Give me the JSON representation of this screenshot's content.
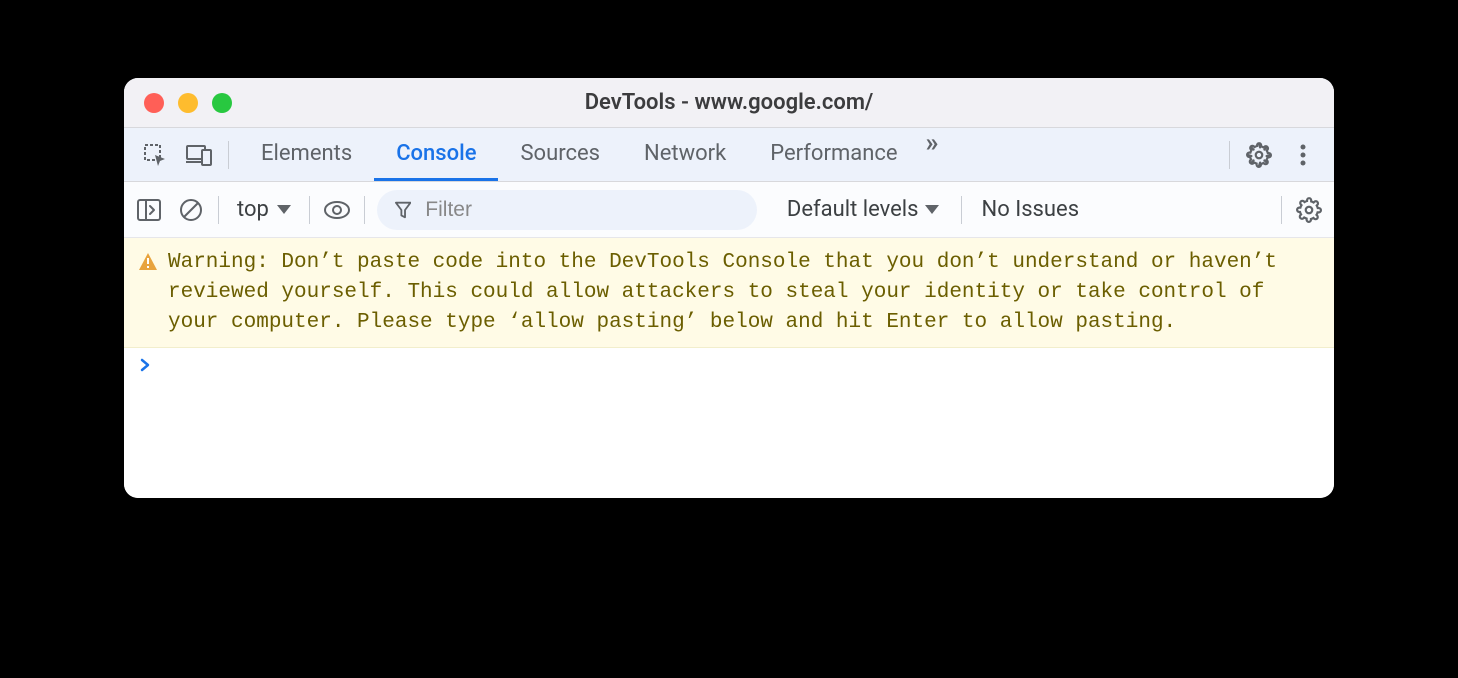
{
  "window": {
    "title": "DevTools - www.google.com/"
  },
  "tabs": {
    "items": [
      "Elements",
      "Console",
      "Sources",
      "Network",
      "Performance"
    ],
    "active_index": 1
  },
  "toolbar": {
    "context": "top",
    "filter_placeholder": "Filter",
    "levels_label": "Default levels",
    "issues_label": "No Issues"
  },
  "console": {
    "warning": "Warning: Don’t paste code into the DevTools Console that you don’t understand or haven’t reviewed yourself. This could allow attackers to steal your identity or take control of your computer. Please type ‘allow pasting’ below and hit Enter to allow pasting."
  }
}
